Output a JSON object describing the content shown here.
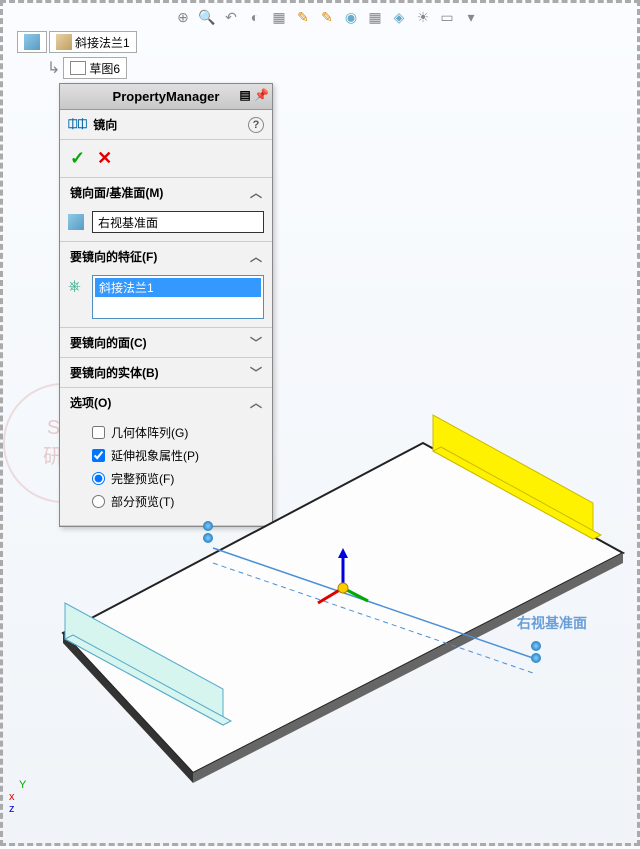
{
  "toolbar_icons": [
    "cube",
    "zoom-prev",
    "zoom-fit",
    "zoom-area",
    "magnifier",
    "view-orient",
    "display-style",
    "section",
    "hide-show",
    "appearance",
    "scene",
    "render",
    "screen"
  ],
  "breadcrumb": {
    "root_label": "斜接法兰1",
    "sub_label": "草图6"
  },
  "panel": {
    "header": "PropertyManager",
    "title": "镜向",
    "sections": {
      "mirror_plane": {
        "label": "镜向面/基准面(M)",
        "value": "右视基准面"
      },
      "features": {
        "label": "要镜向的特征(F)",
        "items": [
          "斜接法兰1"
        ]
      },
      "faces": {
        "label": "要镜向的面(C)"
      },
      "bodies": {
        "label": "要镜向的实体(B)"
      },
      "options": {
        "label": "选项(O)",
        "geometry_pattern": "几何体阵列(G)",
        "propagate": "延伸视象属性(P)",
        "full_preview": "完整预览(F)",
        "partial_preview": "部分预览(T)"
      }
    }
  },
  "viewport": {
    "plane_label": "右视基准面",
    "axes": {
      "x": "x",
      "y": "Y",
      "z": "z"
    }
  },
  "watermark": {
    "top": "SW",
    "bottom": "研习"
  }
}
